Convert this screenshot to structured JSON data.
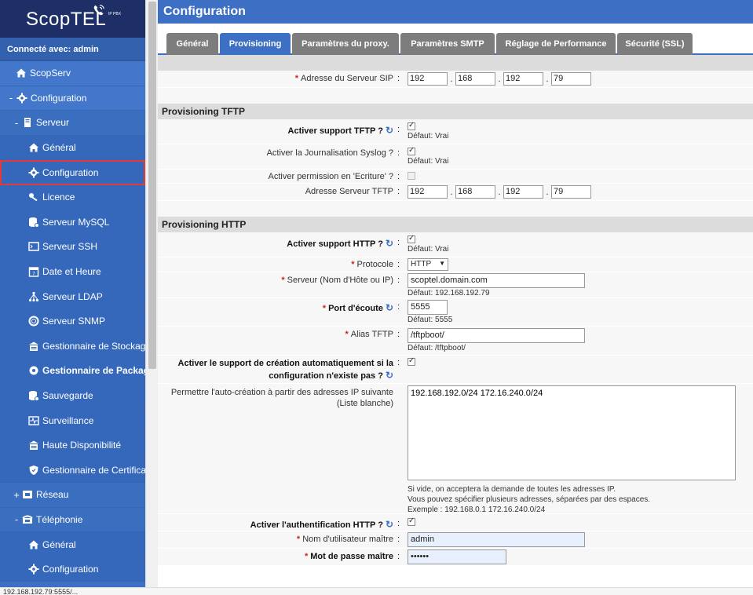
{
  "app": {
    "logo_main": "Scop",
    "logo_tel": "TEL",
    "logo_sub": "IP PBX",
    "connected": "Connecté avec: admin"
  },
  "sidebar": {
    "items": [
      {
        "label": "ScopServ",
        "icon": "home-icon",
        "level": 0
      },
      {
        "label": "Configuration",
        "icon": "gear-icon",
        "level": 0,
        "toggle": "-"
      },
      {
        "label": "Serveur",
        "icon": "server-icon",
        "level": 1,
        "toggle": "-"
      },
      {
        "label": "Général",
        "icon": "home-icon",
        "level": 2
      },
      {
        "label": "Configuration",
        "icon": "gear-icon",
        "level": 2
      },
      {
        "label": "Licence",
        "icon": "key-icon",
        "level": 2
      },
      {
        "label": "Serveur MySQL",
        "icon": "database-icon",
        "level": 2
      },
      {
        "label": "Serveur SSH",
        "icon": "terminal-icon",
        "level": 2
      },
      {
        "label": "Date et Heure",
        "icon": "calendar-icon",
        "level": 2
      },
      {
        "label": "Serveur LDAP",
        "icon": "sitemap-icon",
        "level": 2
      },
      {
        "label": "Serveur SNMP",
        "icon": "lifebuoy-icon",
        "level": 2
      },
      {
        "label": "Gestionnaire de Stockage",
        "icon": "storage-icon",
        "level": 2
      },
      {
        "label": "Gestionnaire de Package",
        "icon": "package-icon",
        "level": 2
      },
      {
        "label": "Sauvegarde",
        "icon": "database-icon",
        "level": 2
      },
      {
        "label": "Surveillance",
        "icon": "monitor-icon",
        "level": 2
      },
      {
        "label": "Haute Disponibilité",
        "icon": "storage-icon",
        "level": 2
      },
      {
        "label": "Gestionnaire de Certificats",
        "icon": "shield-icon",
        "level": 2
      },
      {
        "label": "Réseau",
        "icon": "network-icon",
        "level": 1,
        "toggle": "+"
      },
      {
        "label": "Téléphonie",
        "icon": "phone-icon",
        "level": 1,
        "toggle": "-"
      },
      {
        "label": "Général",
        "icon": "home-icon",
        "level": 2
      },
      {
        "label": "Configuration",
        "icon": "gear-icon",
        "level": 2
      }
    ]
  },
  "status_bar": "192.168.192.79:5555/...",
  "page": {
    "title": "Configuration",
    "tabs": [
      "Général",
      "Provisioning",
      "Paramètres du proxy.",
      "Paramètres SMTP",
      "Réglage de Performance",
      "Sécurité (SSL)"
    ],
    "active_tab": 1
  },
  "sip": {
    "label": "Adresse du Serveur SIP",
    "ip": [
      "192",
      "168",
      "192",
      "79"
    ]
  },
  "tftp": {
    "header": "Provisioning TFTP",
    "enable_label": "Activer support TFTP ?",
    "enable_default": "Défaut: Vrai",
    "syslog_label": "Activer la Journalisation Syslog ?",
    "syslog_default": "Défaut: Vrai",
    "write_label": "Activer permission en 'Ecriture' ?",
    "server_label": "Adresse Serveur TFTP",
    "ip": [
      "192",
      "168",
      "192",
      "79"
    ]
  },
  "http": {
    "header": "Provisioning HTTP",
    "enable_label": "Activer support HTTP ?",
    "enable_default": "Défaut: Vrai",
    "protocol_label": "Protocole",
    "protocol_value": "HTTP",
    "server_label": "Serveur (Nom d'Hôte ou IP)",
    "server_value": "scoptel.domain.com",
    "server_default": "Défaut: 192.168.192.79",
    "port_label": "Port d'écoute",
    "port_value": "5555",
    "port_default": "Défaut: 5555",
    "alias_label": "Alias TFTP",
    "alias_value": "/tftpboot/",
    "alias_default": "Défaut: /tftpboot/",
    "autocreate_label_1": "Activer le support de création automatiquement si la",
    "autocreate_label_2": "configuration n'existe pas ?",
    "whitelist_label_1": "Permettre l'auto-création à partir des adresses IP suivante",
    "whitelist_label_2": "(Liste blanche)",
    "whitelist_value": "192.168.192.0/24 172.16.240.0/24",
    "whitelist_hint_1": "Si vide, on acceptera la demande de toutes les adresses IP.",
    "whitelist_hint_2": "Vous pouvez spécifier plusieurs adresses, séparées par des espaces.",
    "whitelist_hint_3": "Exemple : 192.168.0.1 172.16.240.0/24",
    "auth_label": "Activer l'authentification HTTP ?",
    "user_label": "Nom d'utilisateur maître",
    "user_value": "admin",
    "pass_label": "Mot de passe maître",
    "pass_value": "••••••"
  }
}
